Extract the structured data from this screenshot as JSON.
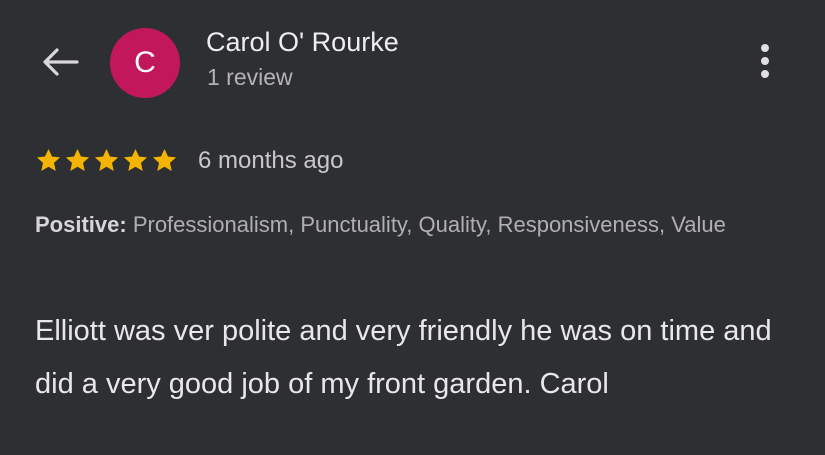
{
  "header": {
    "back_icon": "arrow-left-icon",
    "avatar_letter": "C",
    "avatar_color": "#c2185b",
    "reviewer_name": "Carol O' Rourke",
    "review_count": "1 review",
    "more_icon": "more-vertical-icon"
  },
  "review": {
    "rating": 5,
    "rating_max": 5,
    "star_color": "#f4b400",
    "time_ago": "6 months ago",
    "attributes_label": "Positive:",
    "attributes_value": " Professionalism, Punctuality, Quality, Responsiveness, Value",
    "text": "Elliott was ver polite and very friendly he was on time and did a very good job of my front garden. Carol"
  }
}
